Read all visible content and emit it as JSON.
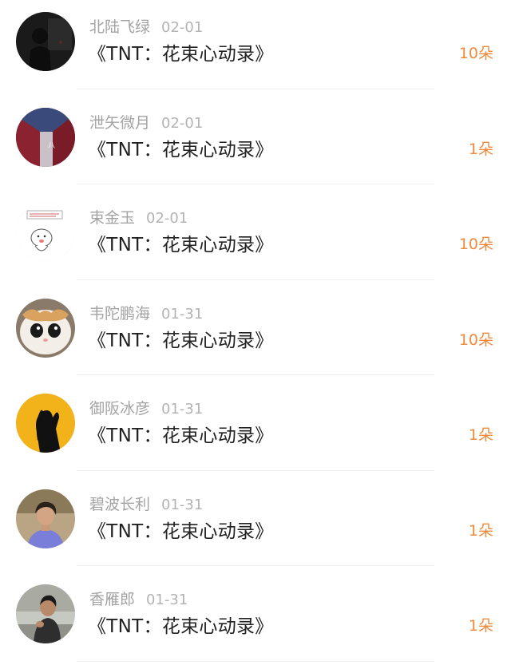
{
  "accent_color": "#f08a3c",
  "items": [
    {
      "user": "北陆飞绿",
      "date": "02-01",
      "title": "《TNT：花束心动录》",
      "count": "10朵",
      "avatar_icon": "dark-silhouette-avatar"
    },
    {
      "user": "泄矢微月",
      "date": "02-01",
      "title": "《TNT：花束心动录》",
      "count": "1朵",
      "avatar_icon": "red-building-avatar"
    },
    {
      "user": "束金玉",
      "date": "02-01",
      "title": "《TNT：花束心动录》",
      "count": "10朵",
      "avatar_icon": "cartoon-avatar"
    },
    {
      "user": "韦陀鹏海",
      "date": "01-31",
      "title": "《TNT：花束心动录》",
      "count": "10朵",
      "avatar_icon": "cat-avatar"
    },
    {
      "user": "御阪冰彦",
      "date": "01-31",
      "title": "《TNT：花束心动录》",
      "count": "1朵",
      "avatar_icon": "yellow-silhouette-avatar"
    },
    {
      "user": "碧波长利",
      "date": "01-31",
      "title": "《TNT：花束心动录》",
      "count": "1朵",
      "avatar_icon": "person-photo-avatar"
    },
    {
      "user": "香雁郎",
      "date": "01-31",
      "title": "《TNT：花束心动录》",
      "count": "1朵",
      "avatar_icon": "person-photo-avatar"
    }
  ]
}
